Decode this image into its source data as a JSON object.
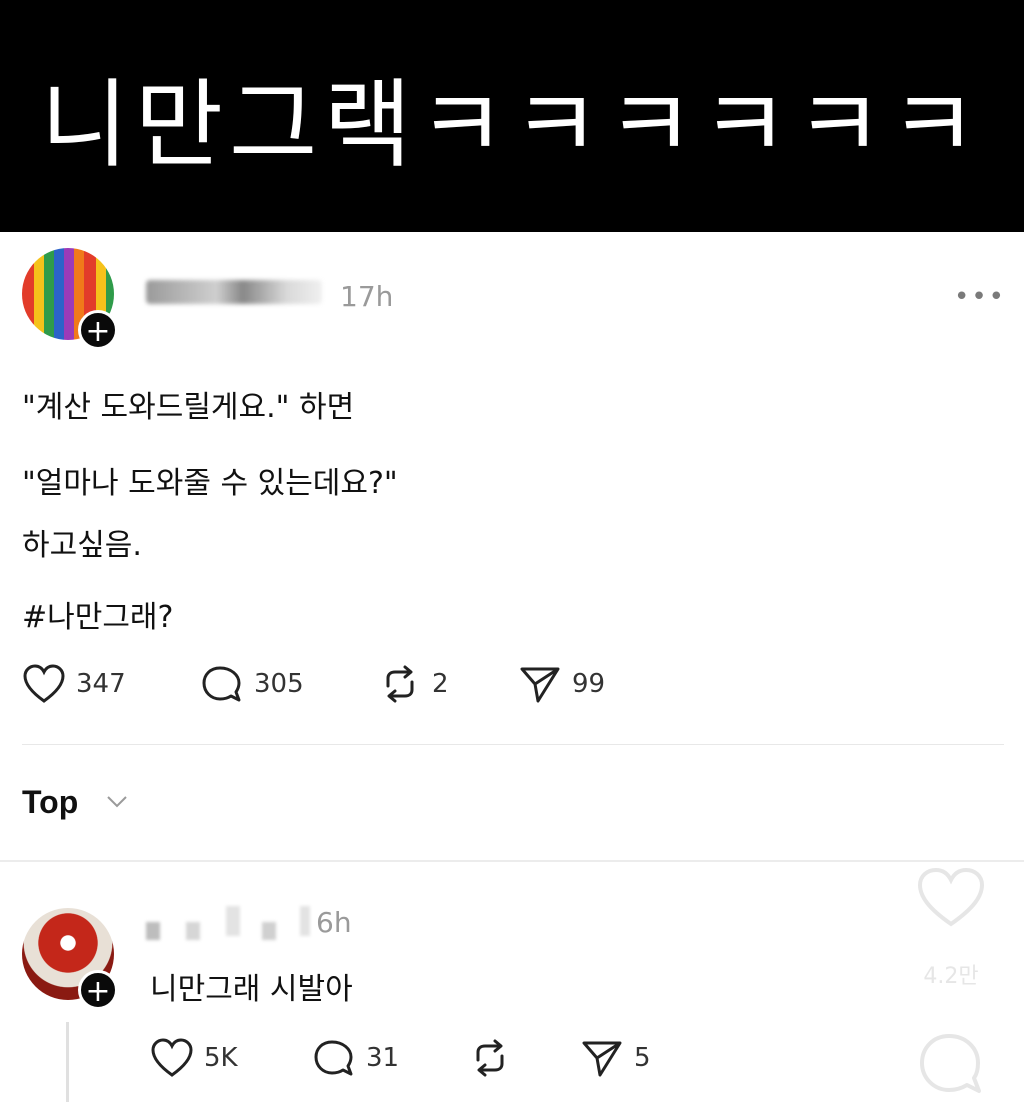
{
  "banner": {
    "caption": "니만그랙ㅋㅋㅋㅋㅋㅋ"
  },
  "post": {
    "time": "17h",
    "lines": [
      "\"계산 도와드릴게요.\" 하면",
      "\"얼마나 도와줄 수 있는데요?\"",
      "하고싶음.",
      "#나만그래?"
    ],
    "actions": {
      "likes": "347",
      "replies": "305",
      "reposts": "2",
      "shares": "99"
    }
  },
  "sort": {
    "label": "Top"
  },
  "reply": {
    "time": "6h",
    "text": "니만그래 시발아",
    "actions": {
      "likes": "5K",
      "replies": "31",
      "shares": "5"
    }
  },
  "overlay": {
    "like_count": "4.2만"
  },
  "icons": [
    "plus-icon",
    "more-icon",
    "heart-icon",
    "comment-icon",
    "repost-icon",
    "share-icon",
    "chevron-down-icon"
  ],
  "colors": {
    "banner_bg": "#000000",
    "banner_text": "#ffffff",
    "muted": "#9a9a9a"
  }
}
